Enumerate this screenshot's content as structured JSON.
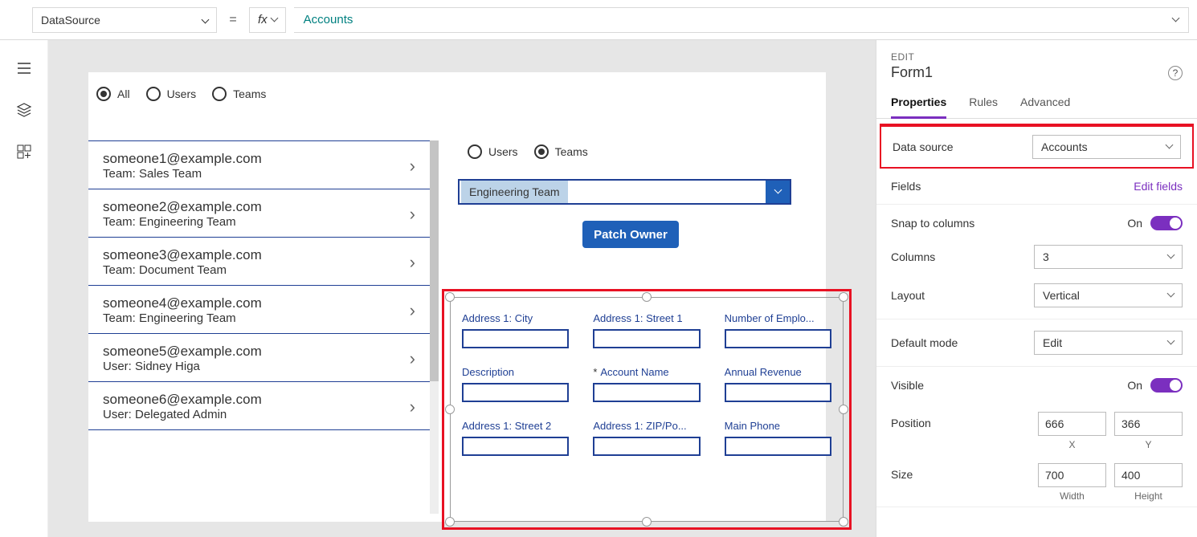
{
  "formula_bar": {
    "property": "DataSource",
    "equals": "=",
    "fx": "fx",
    "value": "Accounts"
  },
  "canvas": {
    "filter_radios": [
      {
        "label": "All",
        "selected": true
      },
      {
        "label": "Users",
        "selected": false
      },
      {
        "label": "Teams",
        "selected": false
      }
    ],
    "gallery": [
      {
        "email": "someone1@example.com",
        "sub": "Team: Sales Team"
      },
      {
        "email": "someone2@example.com",
        "sub": "Team: Engineering Team"
      },
      {
        "email": "someone3@example.com",
        "sub": "Team: Document Team"
      },
      {
        "email": "someone4@example.com",
        "sub": "Team: Engineering Team"
      },
      {
        "email": "someone5@example.com",
        "sub": "User: Sidney Higa"
      },
      {
        "email": "someone6@example.com",
        "sub": "User: Delegated Admin"
      }
    ],
    "form_radios": [
      {
        "label": "Users",
        "selected": false
      },
      {
        "label": "Teams",
        "selected": true
      }
    ],
    "team_dropdown": "Engineering Team",
    "patch_button": "Patch Owner",
    "form_fields": [
      {
        "label": "Address 1: City",
        "required": false
      },
      {
        "label": "Address 1: Street 1",
        "required": false
      },
      {
        "label": "Number of Emplo...",
        "required": false
      },
      {
        "label": "Description",
        "required": false
      },
      {
        "label": "Account Name",
        "required": true
      },
      {
        "label": "Annual Revenue",
        "required": false
      },
      {
        "label": "Address 1: Street 2",
        "required": false
      },
      {
        "label": "Address 1: ZIP/Po...",
        "required": false
      },
      {
        "label": "Main Phone",
        "required": false
      }
    ]
  },
  "panel": {
    "edit_label": "EDIT",
    "title": "Form1",
    "tabs": {
      "properties": "Properties",
      "rules": "Rules",
      "advanced": "Advanced"
    },
    "data_source": {
      "label": "Data source",
      "value": "Accounts"
    },
    "fields": {
      "label": "Fields",
      "link": "Edit fields"
    },
    "snap": {
      "label": "Snap to columns",
      "value": "On"
    },
    "columns": {
      "label": "Columns",
      "value": "3"
    },
    "layout": {
      "label": "Layout",
      "value": "Vertical"
    },
    "default_mode": {
      "label": "Default mode",
      "value": "Edit"
    },
    "visible": {
      "label": "Visible",
      "value": "On"
    },
    "position": {
      "label": "Position",
      "x": "666",
      "y": "366",
      "xlab": "X",
      "ylab": "Y"
    },
    "size": {
      "label": "Size",
      "w": "700",
      "h": "400",
      "wlab": "Width",
      "hlab": "Height"
    }
  }
}
